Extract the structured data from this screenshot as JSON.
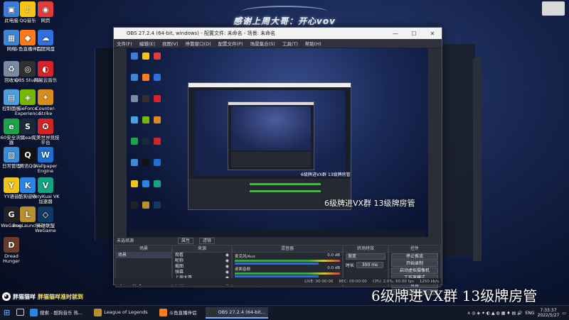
{
  "banner_title": "感谢上周大哥：开心vov",
  "desktop_icons": [
    {
      "label": "此电脑",
      "icon": "computer-icon",
      "color": "#3b7dd8",
      "glyph": "▣"
    },
    {
      "label": "QQ音乐",
      "icon": "qqmusic-icon",
      "color": "#f5c518",
      "glyph": "♪"
    },
    {
      "label": "网页",
      "icon": "browser-icon",
      "color": "#e23b3b",
      "glyph": "◉"
    },
    {
      "label": "网络",
      "icon": "network-icon",
      "color": "#3d86d6",
      "glyph": "▦"
    },
    {
      "label": "斗鱼直播伴侣",
      "icon": "douyu-icon",
      "color": "#ff7a1a",
      "glyph": "◆"
    },
    {
      "label": "百度网盘",
      "icon": "baidunetdisk-icon",
      "color": "#2f6fe0",
      "glyph": "☁"
    },
    {
      "label": "回收站",
      "icon": "recycle-bin-icon",
      "color": "#7a8aa3",
      "glyph": "♻"
    },
    {
      "label": "OBS Studio",
      "icon": "obs-icon",
      "color": "#303030",
      "glyph": "◎"
    },
    {
      "label": "网易云音乐",
      "icon": "netease-music-icon",
      "color": "#d8222a",
      "glyph": "◐"
    },
    {
      "label": "控制面板",
      "icon": "control-panel-icon",
      "color": "#4aa0e0",
      "glyph": "▤"
    },
    {
      "label": "GeForce Experience",
      "icon": "geforce-icon",
      "color": "#76b900",
      "glyph": "◈"
    },
    {
      "label": "Counter-Strike",
      "icon": "csgo-icon",
      "color": "#d98c1a",
      "glyph": "✦"
    },
    {
      "label": "360安全浏览器",
      "icon": "360-browser-icon",
      "color": "#1aa34a",
      "glyph": "e"
    },
    {
      "label": "Steam",
      "icon": "steam-icon",
      "color": "#1b2838",
      "glyph": "S"
    },
    {
      "label": "完美世界竞技平台",
      "icon": "perfect-world-icon",
      "color": "#d02525",
      "glyph": "✪"
    },
    {
      "label": "日常管理",
      "icon": "manager-icon",
      "color": "#3b8ad8",
      "glyph": "▧"
    },
    {
      "label": "腾讯QQ",
      "icon": "qq-icon",
      "color": "#111",
      "glyph": "Q"
    },
    {
      "label": "Wallpaper Engine",
      "icon": "wallpaper-engine-icon",
      "color": "#1e6fd0",
      "glyph": "W"
    },
    {
      "label": "YY语音",
      "icon": "yy-icon",
      "color": "#f0c419",
      "glyph": "Y"
    },
    {
      "label": "酷狗音乐",
      "icon": "kugou-icon",
      "color": "#2a85e8",
      "glyph": "K"
    },
    {
      "label": "VeryKuai VK加速器",
      "icon": "verykuai-icon",
      "color": "#14a37f",
      "glyph": "V"
    },
    {
      "label": "WeGame",
      "icon": "wegame-icon",
      "color": "#222",
      "glyph": "G"
    },
    {
      "label": "BugLauncher",
      "icon": "lol-launcher-icon",
      "color": "#b8902c",
      "glyph": "L"
    },
    {
      "label": "英雄联盟WeGame",
      "icon": "lol-icon",
      "color": "#0f3a63",
      "glyph": "◇"
    },
    {
      "label": "Dread Hunger",
      "icon": "dread-hunger-icon",
      "color": "#6b3a2a",
      "glyph": "D"
    }
  ],
  "obs": {
    "title": "OBS 27.2.4 (64-bit, windows) - 配置文件: 未命名 - 场景: 未命名",
    "menu": [
      "文件(F)",
      "编辑(E)",
      "视图(V)",
      "停靠窗口(D)",
      "配置文件(P)",
      "场景集合(S)",
      "工具(T)",
      "帮助(H)"
    ],
    "no_source_selected": "未选择源",
    "properties_label": "属性",
    "filters_label": "滤镜",
    "docks": {
      "scenes": {
        "title": "场景",
        "items": [
          "场景"
        ]
      },
      "sources": {
        "title": "来源",
        "items": [
          "观看",
          "昵称",
          "截图",
          "弹幕",
          "上周大哥",
          "弹幕"
        ]
      },
      "mixer": {
        "title": "混音器",
        "channels": [
          {
            "name": "桌面音频",
            "level": "0.0 dB"
          },
          {
            "name": "麦克风/Aux",
            "level": "0.0 dB"
          }
        ]
      },
      "transitions": {
        "title": "转场特效",
        "type": "渐变",
        "duration_label": "时长",
        "duration": "300 ms"
      },
      "controls": {
        "title": "控件",
        "buttons": [
          "停止推流",
          "开始录制",
          "启动虚拟摄像机",
          "工作室模式",
          "设置",
          "退出"
        ]
      }
    },
    "status": {
      "live": "LIVE: 00:00:00",
      "rec": "REC: 00:00:00",
      "cpu": "CPU: 2.0%, 60.00 fps",
      "kbps": "1250 kb/s"
    }
  },
  "overlay_small": "6级牌进VX群  13级牌房管",
  "overlay_big": "6级牌进VX群  13级牌房管",
  "brand": {
    "name": "胖猫猫咩",
    "slogan": "胖猫猫咩准时就到"
  },
  "taskbar": {
    "items": [
      {
        "label": "搜索 - 酷狗音乐 热...",
        "icon": "kugou-icon",
        "color": "#2a85e8",
        "active": false
      },
      {
        "label": "League of Legends",
        "icon": "lol-icon",
        "color": "#b8902c",
        "active": false
      },
      {
        "label": "斗鱼直播伴侣",
        "icon": "douyu-icon",
        "color": "#ff7a1a",
        "active": false
      },
      {
        "label": "OBS 27.2.4 (64-bit...",
        "icon": "obs-icon",
        "color": "#303030",
        "active": true
      }
    ],
    "lang": "ENG",
    "time": "7:33:37",
    "date": "2022/5/27"
  }
}
